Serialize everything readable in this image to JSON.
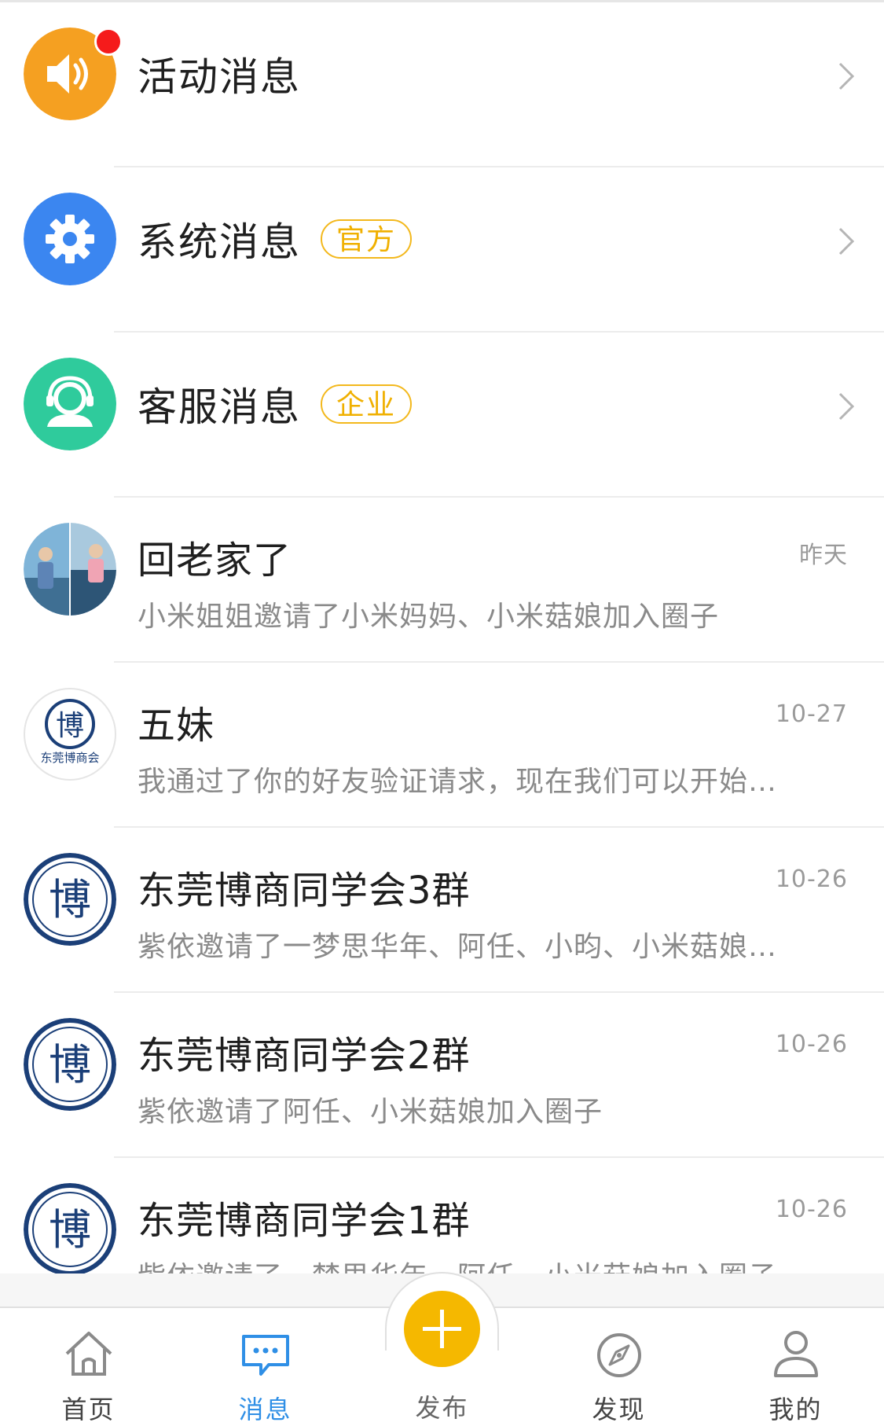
{
  "system_rows": [
    {
      "title": "活动消息",
      "tag": "",
      "icon": "speaker-icon",
      "color": "#f5a021",
      "has_dot": true
    },
    {
      "title": "系统消息",
      "tag": "官方",
      "icon": "gear-icon",
      "color": "#3b86f0",
      "has_dot": false
    },
    {
      "title": "客服消息",
      "tag": "企业",
      "icon": "headset-icon",
      "color": "#2fcb9c",
      "has_dot": false
    }
  ],
  "chats": [
    {
      "title": "回老家了",
      "preview": "小米姐姐邀请了小米妈妈、小米菇娘加入圈子",
      "time": "昨天"
    },
    {
      "title": "五妹",
      "preview": "我通过了你的好友验证请求，现在我们可以开始…",
      "time": "10-27"
    },
    {
      "title": "东莞博商同学会3群",
      "preview": "紫依邀请了一梦思华年、阿任、小昀、小米菇娘…",
      "time": "10-26"
    },
    {
      "title": "东莞博商同学会2群",
      "preview": "紫依邀请了阿任、小米菇娘加入圈子",
      "time": "10-26"
    },
    {
      "title": "东莞博商同学会1群",
      "preview": "紫依邀请了一梦思华年、阿任、小米菇娘加入圈子",
      "time": "10-26"
    }
  ],
  "avatar_text": {
    "boshang_char": "博",
    "boshang_name": "东莞博商会"
  },
  "tabbar": {
    "home": "首页",
    "messages": "消息",
    "publish": "发布",
    "discover": "发现",
    "mine": "我的"
  },
  "colors": {
    "accent_blue": "#2f8fe6",
    "publish_yellow": "#f5b800",
    "tag_yellow": "#f3b81c",
    "badge_red": "#f51b1b"
  }
}
